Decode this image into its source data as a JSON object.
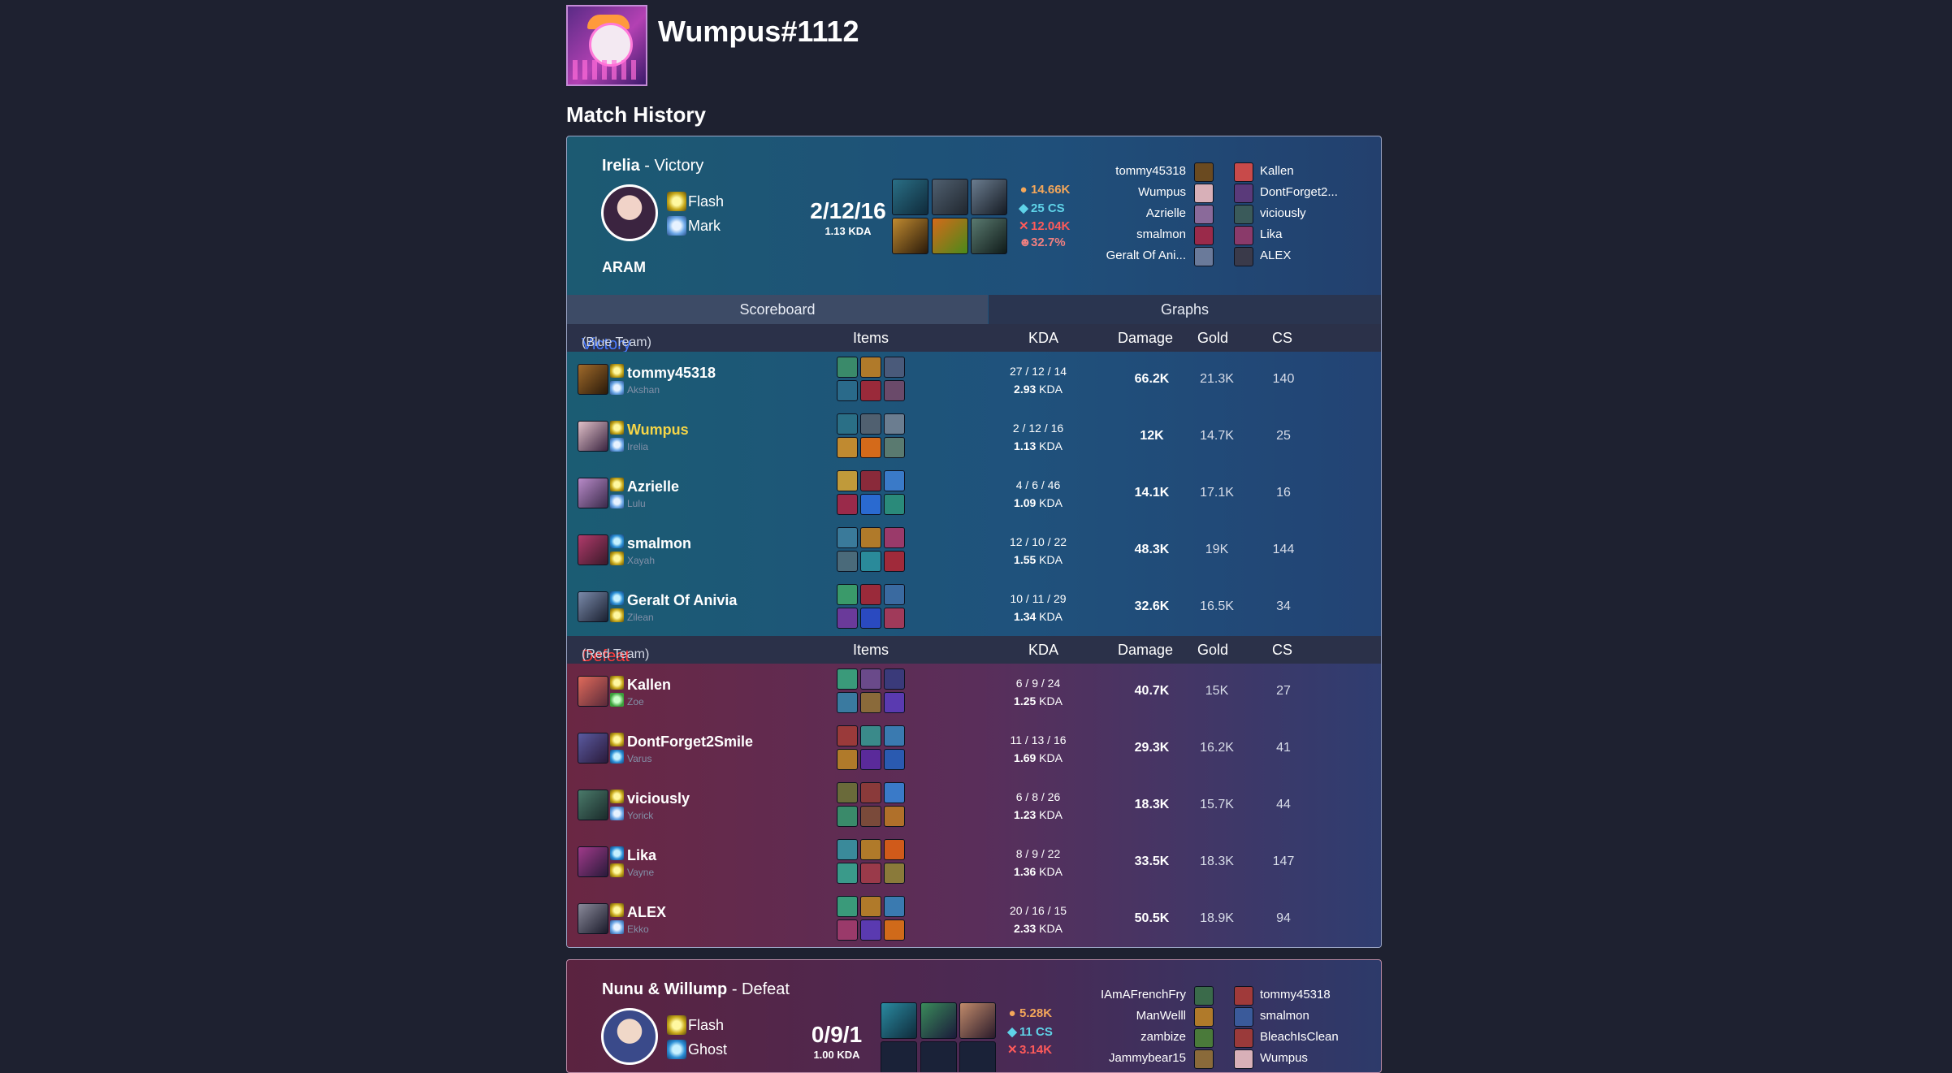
{
  "profile": {
    "name": "Wumpus#1112",
    "avatar_icon": "neon-poro-icon"
  },
  "section_title": "Match History",
  "match": {
    "champion": "Irelia",
    "result": "Victory",
    "mode": "ARAM",
    "spells": [
      {
        "name": "Flash",
        "icon": "flash-icon"
      },
      {
        "name": "Mark",
        "icon": "mark-icon"
      }
    ],
    "kda": "2/12/16",
    "kda_ratio": "1.13 KDA",
    "stats": {
      "gold": "14.66K",
      "cs": "25 CS",
      "damage": "12.04K",
      "kill_participation": "32.7%"
    },
    "team_blue_names": [
      "tommy45318",
      "Wumpus",
      "Azrielle",
      "smalmon",
      "Geralt Of Ani..."
    ],
    "team_red_names": [
      "Kallen",
      "DontForget2...",
      "viciously",
      "Lika",
      "ALEX"
    ],
    "tabs": {
      "scoreboard": "Scoreboard",
      "graphs": "Graphs"
    },
    "headers": {
      "items": "Items",
      "kda": "KDA",
      "damage": "Damage",
      "gold": "Gold",
      "cs": "CS"
    },
    "blue": {
      "result": "Victory",
      "team_label": "(Blue Team)",
      "color": "#3b6cff",
      "players": [
        {
          "name": "tommy45318",
          "champ": "Akshan",
          "k": "27",
          "d": "12",
          "a": "14",
          "ratio": "2.93",
          "dmg": "66.2K",
          "gold": "21.3K",
          "cs": "140"
        },
        {
          "name": "Wumpus",
          "champ": "Irelia",
          "k": "2",
          "d": "12",
          "a": "16",
          "ratio": "1.13",
          "dmg": "12K",
          "gold": "14.7K",
          "cs": "25",
          "highlight": true
        },
        {
          "name": "Azrielle",
          "champ": "Lulu",
          "k": "4",
          "d": "6",
          "a": "46",
          "ratio": "1.09",
          "dmg": "14.1K",
          "gold": "17.1K",
          "cs": "16"
        },
        {
          "name": "smalmon",
          "champ": "Xayah",
          "k": "12",
          "d": "10",
          "a": "22",
          "ratio": "1.55",
          "dmg": "48.3K",
          "gold": "19K",
          "cs": "144"
        },
        {
          "name": "Geralt Of Anivia",
          "champ": "Zilean",
          "k": "10",
          "d": "11",
          "a": "29",
          "ratio": "1.34",
          "dmg": "32.6K",
          "gold": "16.5K",
          "cs": "34"
        }
      ]
    },
    "red": {
      "result": "Defeat",
      "team_label": "(Red Team)",
      "color": "#ff3b3b",
      "players": [
        {
          "name": "Kallen",
          "champ": "Zoe",
          "k": "6",
          "d": "9",
          "a": "24",
          "ratio": "1.25",
          "dmg": "40.7K",
          "gold": "15K",
          "cs": "27"
        },
        {
          "name": "DontForget2Smile",
          "champ": "Varus",
          "k": "11",
          "d": "13",
          "a": "16",
          "ratio": "1.69",
          "dmg": "29.3K",
          "gold": "16.2K",
          "cs": "41"
        },
        {
          "name": "viciously",
          "champ": "Yorick",
          "k": "6",
          "d": "8",
          "a": "26",
          "ratio": "1.23",
          "dmg": "18.3K",
          "gold": "15.7K",
          "cs": "44"
        },
        {
          "name": "Lika",
          "champ": "Vayne",
          "k": "8",
          "d": "9",
          "a": "22",
          "ratio": "1.36",
          "dmg": "33.5K",
          "gold": "18.3K",
          "cs": "147"
        },
        {
          "name": "ALEX",
          "champ": "Ekko",
          "k": "20",
          "d": "16",
          "a": "15",
          "ratio": "2.33",
          "dmg": "50.5K",
          "gold": "18.9K",
          "cs": "94"
        }
      ]
    },
    "kda_suffix": "KDA",
    "highlight_color": "#f5d547"
  },
  "match2": {
    "champion": "Nunu & Willump",
    "result": "Defeat",
    "spells": [
      {
        "name": "Flash",
        "icon": "flash-icon"
      },
      {
        "name": "Ghost",
        "icon": "ghost-icon"
      }
    ],
    "kda": "0/9/1",
    "kda_ratio": "1.00 KDA",
    "stats": {
      "gold": "5.28K",
      "cs": "11 CS",
      "damage": "3.14K"
    },
    "team_blue_names": [
      "IAmAFrenchFry",
      "ManWelll",
      "zambize",
      "Jammybear15"
    ],
    "team_red_names": [
      "tommy45318",
      "smalmon",
      "BleachIsClean",
      "Wumpus"
    ]
  }
}
